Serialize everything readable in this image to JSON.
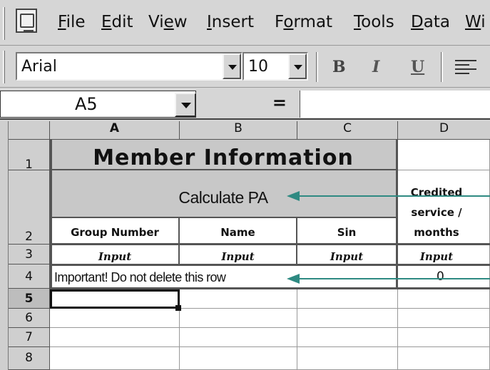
{
  "menu": {
    "items": [
      {
        "label": "File",
        "u": "F",
        "rest": "ile"
      },
      {
        "label": "Edit",
        "u": "E",
        "rest": "dit"
      },
      {
        "label": "View",
        "pre": "Vi",
        "u": "e",
        "rest": "w"
      },
      {
        "label": "Insert",
        "u": "I",
        "rest": "nsert"
      },
      {
        "label": "Format",
        "pre": "F",
        "u": "o",
        "rest": "rmat"
      },
      {
        "label": "Tools",
        "u": "T",
        "rest": "ools"
      },
      {
        "label": "Data",
        "u": "D",
        "rest": "ata"
      },
      {
        "label": "Wi",
        "u": "W",
        "rest": "i"
      }
    ]
  },
  "toolbar": {
    "font_name": "Arial",
    "font_size": "10",
    "bold_label": "B",
    "italic_label": "I",
    "underline_label": "U",
    "align_icon": "align-left-icon"
  },
  "formula_bar": {
    "cell_ref": "A5",
    "eq_label": "=",
    "formula_value": ""
  },
  "grid": {
    "columns": [
      "A",
      "B",
      "C",
      "D"
    ],
    "rows": [
      "1",
      "2",
      "3",
      "4",
      "5",
      "6",
      "7",
      "8"
    ],
    "active_row": "5",
    "title": "Member Information",
    "calculate": "Calculate PA",
    "headers": {
      "group_number": "Group Number",
      "name": "Name",
      "sin": "Sin",
      "credited_1": "Credited",
      "credited_2": "service /",
      "credited_3": "months"
    },
    "input_label": "Input",
    "important_note": "Important! Do not delete this row",
    "d4_value": "0"
  },
  "colors": {
    "arrow": "#2e8a82",
    "grey_cell": "#c8c8c8"
  }
}
